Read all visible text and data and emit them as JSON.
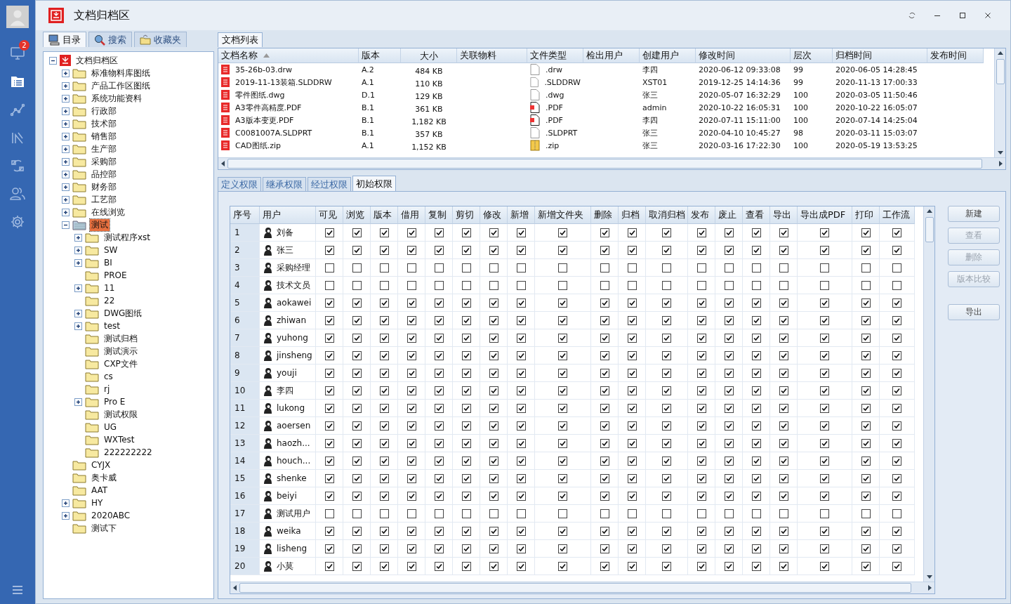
{
  "rail": {
    "items": [
      {
        "kind": "monitor",
        "selected": false,
        "badge": "2"
      },
      {
        "kind": "list",
        "selected": true
      },
      {
        "kind": "chart",
        "selected": false
      },
      {
        "kind": "tools",
        "selected": false
      },
      {
        "kind": "sync",
        "selected": false
      },
      {
        "kind": "users",
        "selected": false
      },
      {
        "kind": "settings",
        "selected": false
      }
    ]
  },
  "window": {
    "title": "文档归档区"
  },
  "left_tabs": [
    {
      "label": "目录",
      "kind": "catalog",
      "selected": true
    },
    {
      "label": "搜索",
      "kind": "search",
      "selected": false
    },
    {
      "label": "收藏夹",
      "kind": "favorites",
      "selected": false
    }
  ],
  "tree": {
    "root": {
      "label": "文档归档区",
      "collapsed": false,
      "selected": false,
      "children": [
        {
          "label": "标准物料库图纸",
          "collapsed": true,
          "selected": false
        },
        {
          "label": "产品工作区图纸",
          "collapsed": true,
          "selected": false
        },
        {
          "label": "系统功能资料",
          "collapsed": true,
          "selected": false
        },
        {
          "label": "行政部",
          "collapsed": true,
          "selected": false
        },
        {
          "label": "技术部",
          "collapsed": true,
          "selected": false
        },
        {
          "label": "销售部",
          "collapsed": true,
          "selected": false
        },
        {
          "label": "生产部",
          "collapsed": true,
          "selected": false
        },
        {
          "label": "采购部",
          "collapsed": true,
          "selected": false
        },
        {
          "label": "品控部",
          "collapsed": true,
          "selected": false
        },
        {
          "label": "财务部",
          "collapsed": true,
          "selected": false
        },
        {
          "label": "工艺部",
          "collapsed": true,
          "selected": false
        },
        {
          "label": "在线浏览",
          "collapsed": true,
          "selected": false
        },
        {
          "label": "测试",
          "collapsed": false,
          "selected": true,
          "children": [
            {
              "label": "测试程序xst",
              "collapsed": true,
              "selected": false
            },
            {
              "label": "SW",
              "collapsed": true,
              "selected": false
            },
            {
              "label": "BI",
              "collapsed": true,
              "selected": false
            },
            {
              "label": "PROE",
              "collapsed": false,
              "selected": false
            },
            {
              "label": "11",
              "collapsed": true,
              "selected": false
            },
            {
              "label": "22",
              "collapsed": false,
              "selected": false
            },
            {
              "label": "DWG图纸",
              "collapsed": true,
              "selected": false
            },
            {
              "label": "test",
              "collapsed": true,
              "selected": false
            },
            {
              "label": "测试归档",
              "collapsed": false,
              "selected": false
            },
            {
              "label": "测试演示",
              "collapsed": false,
              "selected": false
            },
            {
              "label": "CXP文件",
              "collapsed": false,
              "selected": false
            },
            {
              "label": "cs",
              "collapsed": false,
              "selected": false
            },
            {
              "label": "rj",
              "collapsed": false,
              "selected": false
            },
            {
              "label": "Pro E",
              "collapsed": true,
              "selected": false
            },
            {
              "label": "测试权限",
              "collapsed": false,
              "selected": false
            },
            {
              "label": "UG",
              "collapsed": false,
              "selected": false
            },
            {
              "label": "WXTest",
              "collapsed": false,
              "selected": false
            },
            {
              "label": "222222222",
              "collapsed": false,
              "selected": false
            }
          ]
        },
        {
          "label": "CYJX",
          "collapsed": false,
          "selected": false
        },
        {
          "label": "奥卡威",
          "collapsed": false,
          "selected": false
        },
        {
          "label": "AAT",
          "collapsed": false,
          "selected": false
        },
        {
          "label": "HY",
          "collapsed": true,
          "selected": false
        },
        {
          "label": "2020ABC",
          "collapsed": true,
          "selected": false
        },
        {
          "label": "测试下",
          "collapsed": false,
          "selected": false
        }
      ]
    }
  },
  "doc_list": {
    "tab": "文档列表",
    "columns": [
      {
        "label": "文档名称",
        "sorted": true
      },
      {
        "label": "版本"
      },
      {
        "label": "大小"
      },
      {
        "label": "关联物料"
      },
      {
        "label": "文件类型"
      },
      {
        "label": "检出用户"
      },
      {
        "label": "创建用户"
      },
      {
        "label": "修改时间"
      },
      {
        "label": "层次"
      },
      {
        "label": "归档时间"
      },
      {
        "label": "发布时间"
      }
    ],
    "rows": [
      {
        "name": "35-26b-03.drw",
        "version": "A.2",
        "size": "484 KB",
        "type": ".drw",
        "kind": "blank",
        "creator": "李四",
        "modified": "2020-06-12 09:33:08",
        "tier": "99",
        "archived": "2020-06-05 14:28:45"
      },
      {
        "name": "2019-11-13装箱.SLDDRW",
        "version": "A.1",
        "size": "110 KB",
        "type": ".SLDDRW",
        "kind": "blank",
        "creator": "XST01",
        "modified": "2019-12-25 14:14:36",
        "tier": "99",
        "archived": "2020-11-13 17:00:33"
      },
      {
        "name": "零件图纸.dwg",
        "version": "D.1",
        "size": "129 KB",
        "type": ".dwg",
        "kind": "blank",
        "creator": "张三",
        "modified": "2020-05-07 16:32:29",
        "tier": "100",
        "archived": "2020-03-05 11:50:46"
      },
      {
        "name": "A3零件高精度.PDF",
        "version": "B.1",
        "size": "361 KB",
        "type": ".PDF",
        "kind": "pdf",
        "creator": "admin",
        "modified": "2020-10-22 16:05:31",
        "tier": "100",
        "archived": "2020-10-22 16:05:07"
      },
      {
        "name": "A3版本变更.PDF",
        "version": "B.1",
        "size": "1,182 KB",
        "type": ".PDF",
        "kind": "pdf",
        "creator": "李四",
        "modified": "2020-07-11 15:11:00",
        "tier": "100",
        "archived": "2020-07-14 14:25:04"
      },
      {
        "name": "C0081007A.SLDPRT",
        "version": "B.1",
        "size": "357 KB",
        "type": ".SLDPRT",
        "kind": "blank",
        "creator": "张三",
        "modified": "2020-04-10 10:45:27",
        "tier": "98",
        "archived": "2020-03-11 15:03:07"
      },
      {
        "name": "CAD图纸.zip",
        "version": "A.1",
        "size": "1,152 KB",
        "type": ".zip",
        "kind": "zip",
        "creator": "张三",
        "modified": "2020-03-16 17:22:30",
        "tier": "100",
        "archived": "2020-05-19 13:53:25"
      }
    ]
  },
  "perm_tabs": [
    {
      "label": "定义权限",
      "selected": false
    },
    {
      "label": "继承权限",
      "selected": false
    },
    {
      "label": "经过权限",
      "selected": false
    },
    {
      "label": "初始权限",
      "selected": true
    }
  ],
  "perm_grid": {
    "columns": [
      "序号",
      "用户",
      "可见",
      "浏览",
      "版本",
      "借用",
      "复制",
      "剪切",
      "修改",
      "新增",
      "新增文件夹",
      "删除",
      "归档",
      "取消归档",
      "发布",
      "废止",
      "查看",
      "导出",
      "导出成PDF",
      "打印",
      "工作流"
    ],
    "rows": [
      {
        "no": "1",
        "user": "刘备",
        "perms": [
          true,
          true,
          true,
          true,
          true,
          true,
          true,
          true,
          true,
          true,
          true,
          true,
          true,
          true,
          true,
          true,
          true,
          true,
          true
        ]
      },
      {
        "no": "2",
        "user": "张三",
        "perms": [
          true,
          true,
          true,
          true,
          true,
          true,
          true,
          true,
          true,
          true,
          true,
          true,
          true,
          true,
          true,
          true,
          true,
          true,
          true
        ]
      },
      {
        "no": "3",
        "user": "采购经理",
        "perms": [
          false,
          false,
          false,
          false,
          false,
          false,
          false,
          false,
          false,
          false,
          false,
          false,
          false,
          false,
          false,
          false,
          false,
          false,
          false
        ]
      },
      {
        "no": "4",
        "user": "技术文员",
        "perms": [
          false,
          false,
          false,
          false,
          false,
          false,
          false,
          false,
          false,
          false,
          false,
          false,
          false,
          false,
          false,
          false,
          false,
          false,
          false
        ]
      },
      {
        "no": "5",
        "user": "aokawei",
        "perms": [
          true,
          true,
          true,
          true,
          true,
          true,
          true,
          true,
          true,
          true,
          true,
          true,
          true,
          true,
          true,
          true,
          true,
          true,
          true
        ]
      },
      {
        "no": "6",
        "user": "zhiwan",
        "perms": [
          true,
          true,
          true,
          true,
          true,
          true,
          true,
          true,
          true,
          true,
          true,
          true,
          true,
          true,
          true,
          true,
          true,
          true,
          true
        ]
      },
      {
        "no": "7",
        "user": "yuhong",
        "perms": [
          true,
          true,
          true,
          true,
          true,
          true,
          true,
          true,
          true,
          true,
          true,
          true,
          true,
          true,
          true,
          true,
          true,
          true,
          true
        ]
      },
      {
        "no": "8",
        "user": "jinsheng",
        "perms": [
          true,
          true,
          true,
          true,
          true,
          true,
          true,
          true,
          true,
          true,
          true,
          true,
          true,
          true,
          true,
          true,
          true,
          true,
          true
        ]
      },
      {
        "no": "9",
        "user": "youji",
        "perms": [
          true,
          true,
          true,
          true,
          true,
          true,
          true,
          true,
          true,
          true,
          true,
          true,
          true,
          true,
          true,
          true,
          true,
          true,
          true
        ]
      },
      {
        "no": "10",
        "user": "李四",
        "perms": [
          true,
          true,
          true,
          true,
          true,
          true,
          true,
          true,
          true,
          true,
          true,
          true,
          true,
          true,
          true,
          true,
          true,
          true,
          true
        ]
      },
      {
        "no": "11",
        "user": "lukong",
        "perms": [
          true,
          true,
          true,
          true,
          true,
          true,
          true,
          true,
          true,
          true,
          true,
          true,
          true,
          true,
          true,
          true,
          true,
          true,
          true
        ]
      },
      {
        "no": "12",
        "user": "aoersen",
        "perms": [
          true,
          true,
          true,
          true,
          true,
          true,
          true,
          true,
          true,
          true,
          true,
          true,
          true,
          true,
          true,
          true,
          true,
          true,
          true
        ]
      },
      {
        "no": "13",
        "user": "haozh...",
        "perms": [
          true,
          true,
          true,
          true,
          true,
          true,
          true,
          true,
          true,
          true,
          true,
          true,
          true,
          true,
          true,
          true,
          true,
          true,
          true
        ]
      },
      {
        "no": "14",
        "user": "houch...",
        "perms": [
          true,
          true,
          true,
          true,
          true,
          true,
          true,
          true,
          true,
          true,
          true,
          true,
          true,
          true,
          true,
          true,
          true,
          true,
          true
        ]
      },
      {
        "no": "15",
        "user": "shenke",
        "perms": [
          true,
          true,
          true,
          true,
          true,
          true,
          true,
          true,
          true,
          true,
          true,
          true,
          true,
          true,
          true,
          true,
          true,
          true,
          true
        ]
      },
      {
        "no": "16",
        "user": "beiyi",
        "perms": [
          true,
          true,
          true,
          true,
          true,
          true,
          true,
          true,
          true,
          true,
          true,
          true,
          true,
          true,
          true,
          true,
          true,
          true,
          true
        ]
      },
      {
        "no": "17",
        "user": "测试用户",
        "perms": [
          false,
          false,
          false,
          false,
          false,
          false,
          false,
          false,
          false,
          false,
          false,
          false,
          false,
          false,
          false,
          false,
          false,
          false,
          false
        ]
      },
      {
        "no": "18",
        "user": "weika",
        "perms": [
          true,
          true,
          true,
          true,
          true,
          true,
          true,
          true,
          true,
          true,
          true,
          true,
          true,
          true,
          true,
          true,
          true,
          true,
          true
        ]
      },
      {
        "no": "19",
        "user": "lisheng",
        "perms": [
          true,
          true,
          true,
          true,
          true,
          true,
          true,
          true,
          true,
          true,
          true,
          true,
          true,
          true,
          true,
          true,
          true,
          true,
          true
        ]
      },
      {
        "no": "20",
        "user": "小莫",
        "perms": [
          true,
          true,
          true,
          true,
          true,
          true,
          true,
          true,
          true,
          true,
          true,
          true,
          true,
          true,
          true,
          true,
          true,
          true,
          true
        ]
      }
    ]
  },
  "buttons": [
    {
      "label": "新建",
      "disabled": false
    },
    {
      "label": "查看",
      "disabled": true
    },
    {
      "label": "删除",
      "disabled": true
    },
    {
      "label": "版本比较",
      "disabled": true
    },
    {
      "label": "导出",
      "disabled": false
    }
  ]
}
